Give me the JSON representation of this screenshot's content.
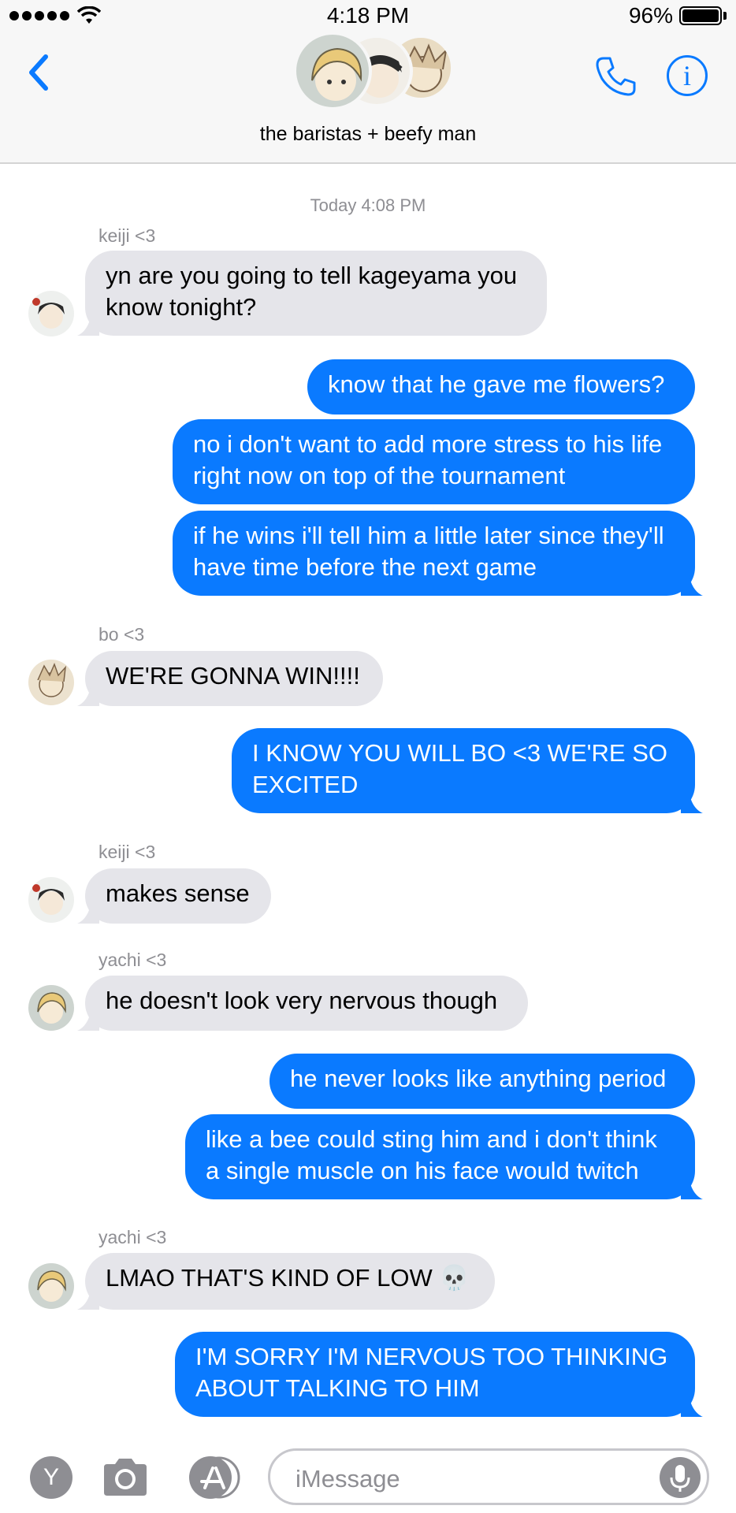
{
  "status_bar": {
    "time": "4:18 PM",
    "battery": "96%"
  },
  "header": {
    "group_name": "the baristas + beefy man"
  },
  "conversation": {
    "timestamp": "Today 4:08 PM",
    "messages": [
      {
        "sender": "keiji <3",
        "text_lines": [
          "yn are you going to tell kageyama you",
          "know tonight?"
        ]
      },
      {
        "text_lines": [
          "know that he gave me flowers?"
        ]
      },
      {
        "text_lines": [
          "no i don't want to add more stress to his life",
          "right now on top of the tournament"
        ]
      },
      {
        "text_lines": [
          "if he wins i'll tell him a little later since they'll",
          "have time before the next game"
        ]
      },
      {
        "sender": "bo <3",
        "text_lines": [
          "WE'RE GONNA WIN!!!!"
        ]
      },
      {
        "text_lines": [
          "I KNOW YOU WILL BO <3 WE'RE SO",
          "EXCITED"
        ]
      },
      {
        "sender": "keiji <3",
        "text_lines": [
          "makes sense"
        ]
      },
      {
        "sender": "yachi <3",
        "text_lines": [
          "he doesn't look very nervous though"
        ]
      },
      {
        "text_lines": [
          "he never looks like anything period"
        ]
      },
      {
        "text_lines": [
          "like a bee could sting him and i don't think",
          "a single muscle on his face would twitch"
        ]
      },
      {
        "sender": "yachi <3",
        "text_lines": [
          "LMAO THAT'S KIND OF LOW 💀"
        ]
      },
      {
        "text_lines": [
          "I'M SORRY I'M NERVOUS TOO THINKING",
          "ABOUT TALKING TO HIM"
        ]
      }
    ]
  },
  "input_bar": {
    "app_letter": "Y",
    "placeholder": "iMessage"
  },
  "colors": {
    "accent": "#0a7aff",
    "incoming_bubble": "#e5e5ea",
    "muted_text": "#8e8e93"
  },
  "icons": [
    "back-chevron-icon",
    "phone-icon",
    "info-icon",
    "camera-icon",
    "app-store-icon",
    "microphone-icon"
  ]
}
